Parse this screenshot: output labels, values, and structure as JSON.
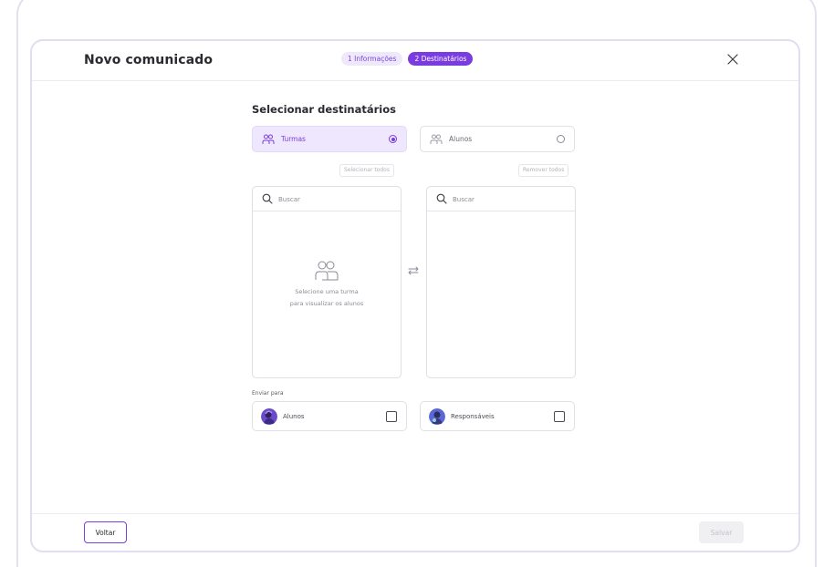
{
  "modal": {
    "title": "Novo comunicado",
    "steps": [
      {
        "label": "1 Informações",
        "state": "inactive"
      },
      {
        "label": "2 Destinatários",
        "state": "active"
      }
    ],
    "close_icon": "close-icon"
  },
  "recipients": {
    "section_title": "Selecionar destinatários",
    "type_options": [
      {
        "label": "Turmas",
        "icon": "users-icon",
        "selected": true
      },
      {
        "label": "Alunos",
        "icon": "users-icon",
        "selected": false
      }
    ],
    "select_all_label": "Selecionar todos",
    "remove_all_label": "Remover todos",
    "source_list": {
      "search_placeholder": "Buscar",
      "empty_line1": "Selecione uma turma",
      "empty_line2": "para visualizar os alunos"
    },
    "target_list": {
      "search_placeholder": "Buscar"
    },
    "transfer_icon": "swap-arrows-icon"
  },
  "send_to": {
    "label": "Enviar para",
    "options": [
      {
        "label": "Alunos",
        "checked": false
      },
      {
        "label": "Responsáveis",
        "checked": false
      }
    ]
  },
  "footer": {
    "back_label": "Voltar",
    "save_label": "Salvar"
  },
  "colors": {
    "accent": "#7a3ce0",
    "accent_light": "#eee7fd",
    "border": "#e0e0e6"
  }
}
